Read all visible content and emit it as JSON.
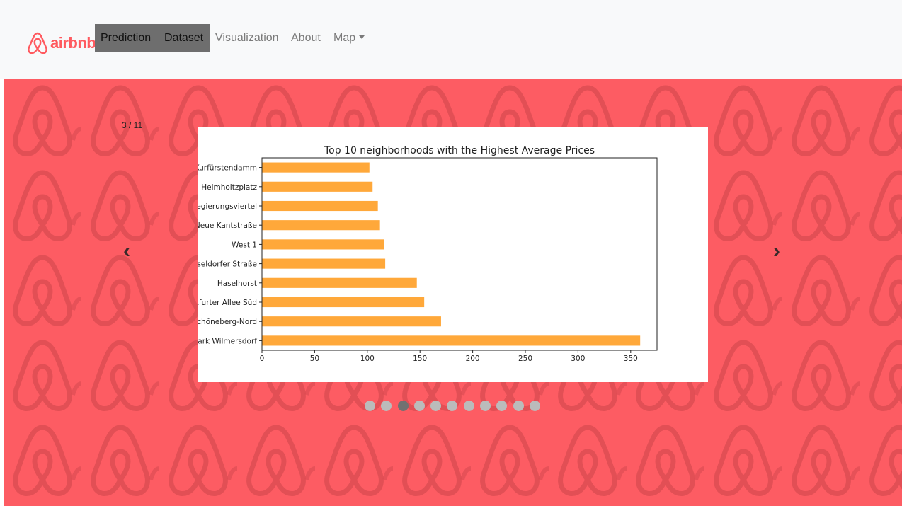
{
  "nav": {
    "brand": "airbnb",
    "links": [
      "Prediction",
      "Dataset",
      "Visualization",
      "About",
      "Map"
    ]
  },
  "carousel": {
    "counter": "3 / 11",
    "prev_label": "‹",
    "next_label": "›",
    "slide_count": 11,
    "active_index": 2,
    "background_color": "#fd5c63"
  },
  "chart_data": {
    "type": "bar",
    "orientation": "horizontal",
    "title": "Top 10 neighborhoods with the Highest Average Prices",
    "categories": [
      "Kurfürstendamm",
      "Helmholtzplatz",
      "Regierungsviertel",
      "Neue Kantstraße",
      "West 1",
      "Düsseldorfer Straße",
      "Haselhorst",
      "Frankfurter Allee Süd",
      "Schöneberg-Nord",
      "Volkspark Wilmersdorf"
    ],
    "values": [
      102,
      105,
      110,
      112,
      116,
      117,
      147,
      154,
      170,
      359
    ],
    "xlim": [
      0,
      375
    ],
    "xticks": [
      0,
      50,
      100,
      150,
      200,
      250,
      300,
      350
    ],
    "bar_color": "#ffa83a",
    "grid": false,
    "legend": false
  }
}
